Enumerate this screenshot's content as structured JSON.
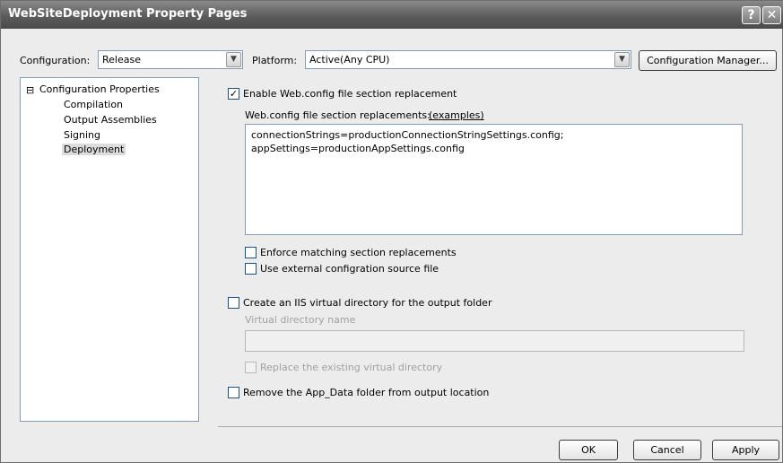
{
  "window": {
    "title": "WebSiteDeployment Property Pages",
    "help_label": "?",
    "close_label": "✕"
  },
  "toolbar": {
    "configuration_label": "Configuration:",
    "configuration_value": "Release",
    "platform_label": "Platform:",
    "platform_value": "Active(Any CPU)",
    "config_manager_label": "Configuration Manager..."
  },
  "tree": {
    "root": "Configuration Properties",
    "expander": "⊟",
    "items": [
      "Compilation",
      "Output Assemblies",
      "Signing",
      "Deployment"
    ],
    "selected": "Deployment"
  },
  "deployment": {
    "enable_replacement_label": "Enable Web.config file section replacement",
    "enable_replacement_checked": true,
    "replacements_label": "Web.config file section replacements:",
    "examples_link": "(examples)",
    "replacements_value": "connectionStrings=productionConnectionStringSettings.config;\nappSettings=productionAppSettings.config",
    "enforce_label": "Enforce matching section replacements",
    "enforce_checked": false,
    "external_source_label": "Use external configration source file",
    "external_source_checked": false,
    "create_vdir_label": "Create an IIS virtual directory for the output folder",
    "create_vdir_checked": false,
    "vdir_name_label": "Virtual directory name",
    "vdir_name_value": "",
    "replace_vdir_label": "Replace the existing virtual directory",
    "replace_vdir_checked": false,
    "remove_appdata_label": "Remove the App_Data folder from output location",
    "remove_appdata_checked": false
  },
  "buttons": {
    "ok": "OK",
    "cancel": "Cancel",
    "apply": "Apply"
  },
  "check_glyph": "✓"
}
